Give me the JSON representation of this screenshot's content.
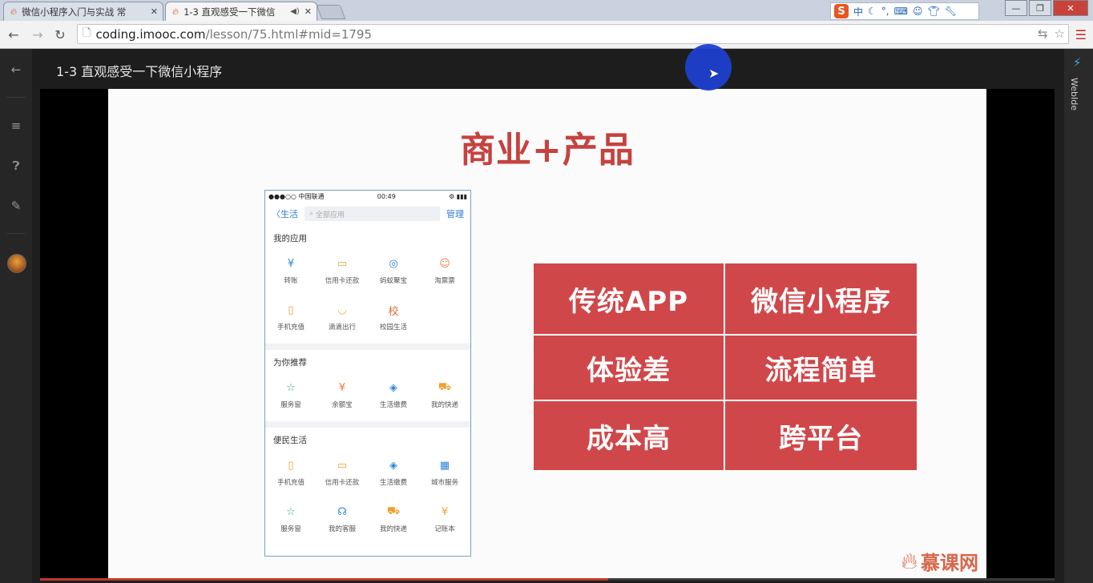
{
  "browser": {
    "tabs": [
      {
        "title": "微信小程序入门与实战 常",
        "active": false
      },
      {
        "title": "1-3 直观感受一下微信",
        "active": true
      }
    ],
    "url_host": "coding.imooc.com",
    "url_path": "/lesson/75.html#mid=1795",
    "ime_label": "S",
    "ime_mode": "中",
    "window_controls": {
      "minimize": "—",
      "restore": "❐",
      "close": "✕"
    }
  },
  "lesson": {
    "title": "1-3 直观感受一下微信小程序",
    "sidebar_right_label": "WebIde"
  },
  "slide": {
    "title": "商业+产品",
    "phone": {
      "status_left": "●●●○○ 中国联通",
      "status_time": "00:49",
      "status_right": "⚙ ▮▮▮",
      "back_label": "〈生活",
      "search_placeholder": "全部应用",
      "manage_label": "管理",
      "sections": [
        {
          "title": "我的应用",
          "items": [
            {
              "label": "转账",
              "icon": "¥",
              "color": "#2e86d6"
            },
            {
              "label": "信用卡还款",
              "icon": "▭",
              "color": "#f0a030"
            },
            {
              "label": "蚂蚁聚宝",
              "icon": "◎",
              "color": "#2e86d6"
            },
            {
              "label": "淘票票",
              "icon": "☺",
              "color": "#f07a40"
            },
            {
              "label": "手机充值",
              "icon": "▯",
              "color": "#f0a030"
            },
            {
              "label": "滴滴出行",
              "icon": "◡",
              "color": "#f0a030"
            },
            {
              "label": "校园生活",
              "icon": "校",
              "color": "#e07040"
            }
          ]
        },
        {
          "title": "为你推荐",
          "items": [
            {
              "label": "服务窗",
              "icon": "☆",
              "color": "#3aa07a"
            },
            {
              "label": "余额宝",
              "icon": "¥",
              "color": "#f07a40"
            },
            {
              "label": "生活缴费",
              "icon": "◈",
              "color": "#2e86d6"
            },
            {
              "label": "我的快递",
              "icon": "⛟",
              "color": "#f0a030"
            }
          ]
        },
        {
          "title": "便民生活",
          "items": [
            {
              "label": "手机充值",
              "icon": "▯",
              "color": "#f0a030"
            },
            {
              "label": "信用卡还款",
              "icon": "▭",
              "color": "#f0a030"
            },
            {
              "label": "生活缴费",
              "icon": "◈",
              "color": "#2e86d6"
            },
            {
              "label": "城市服务",
              "icon": "▦",
              "color": "#2e86d6"
            },
            {
              "label": "服务窗",
              "icon": "☆",
              "color": "#3aa07a"
            },
            {
              "label": "我的客服",
              "icon": "☊",
              "color": "#2e86d6"
            },
            {
              "label": "我的快递",
              "icon": "⛟",
              "color": "#f0a030"
            },
            {
              "label": "记账本",
              "icon": "¥",
              "color": "#f0a030"
            }
          ]
        }
      ]
    },
    "comparison": [
      [
        "传统APP",
        "微信小程序"
      ],
      [
        "体验差",
        "流程简单"
      ],
      [
        "成本高",
        "跨平台"
      ]
    ],
    "logo_text": "慕课网",
    "accent_color": "#c5423f"
  },
  "video": {
    "progress": 0.56
  }
}
